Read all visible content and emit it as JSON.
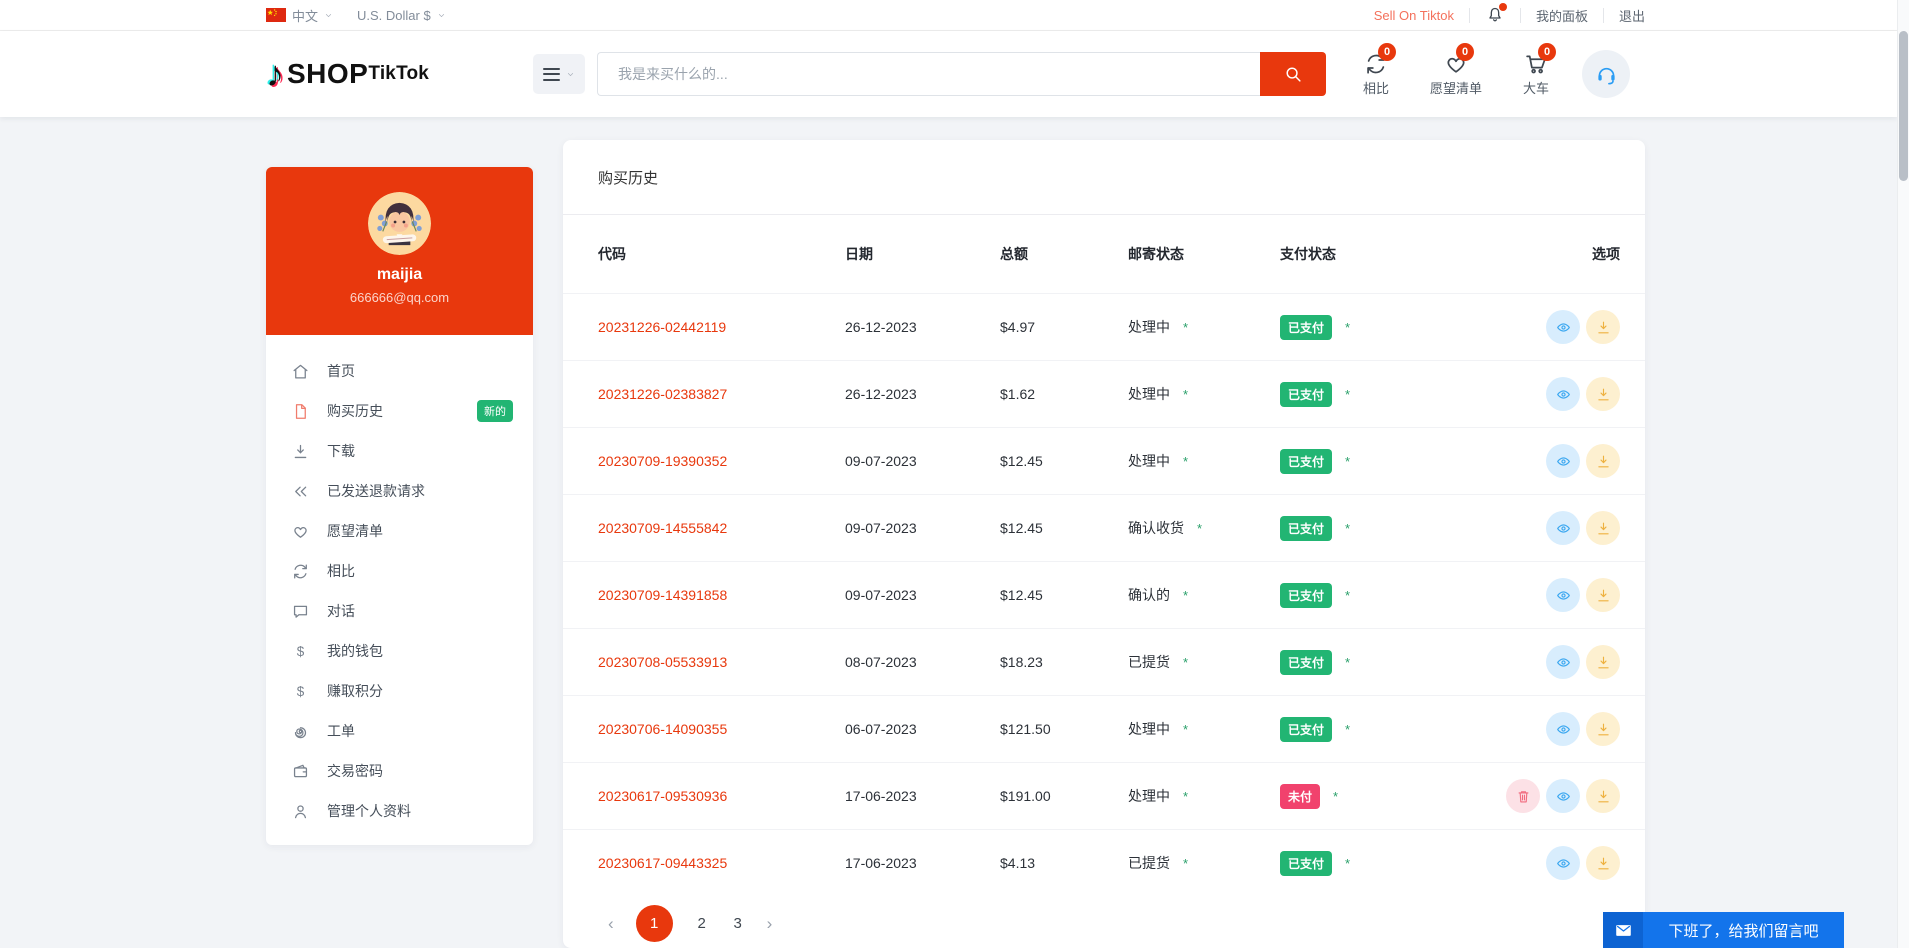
{
  "topbar": {
    "language": "中文",
    "currency": "U.S. Dollar $",
    "sell_on_tiktok": "Sell On Tiktok",
    "my_panel": "我的面板",
    "logout": "退出"
  },
  "header": {
    "logo_shop": "SHOP",
    "logo_tiktok": "TikTok",
    "search_placeholder": "我是来买什么的...",
    "compare": {
      "label": "相比",
      "count": "0"
    },
    "wishlist": {
      "label": "愿望清单",
      "count": "0"
    },
    "cart": {
      "label": "大车",
      "count": "0"
    }
  },
  "sidebar": {
    "user": {
      "name": "maijia",
      "email": "666666@qq.com"
    },
    "items": [
      {
        "label": "首页",
        "icon": "home-icon"
      },
      {
        "label": "购买历史",
        "icon": "file-icon",
        "active": true,
        "badge": "新的"
      },
      {
        "label": "下载",
        "icon": "download-icon"
      },
      {
        "label": "已发送退款请求",
        "icon": "rewind-icon"
      },
      {
        "label": "愿望清单",
        "icon": "heart-icon"
      },
      {
        "label": "相比",
        "icon": "compare-icon"
      },
      {
        "label": "对话",
        "icon": "chat-bubble-icon"
      },
      {
        "label": "我的钱包",
        "icon": "dollar-icon"
      },
      {
        "label": "赚取积分",
        "icon": "dollar-icon"
      },
      {
        "label": "工单",
        "icon": "spiral-icon"
      },
      {
        "label": "交易密码",
        "icon": "wallet-icon"
      },
      {
        "label": "管理个人资料",
        "icon": "person-icon"
      }
    ]
  },
  "main": {
    "title": "购买历史",
    "table": {
      "columns": [
        "代码",
        "日期",
        "总额",
        "邮寄状态",
        "支付状态",
        "选项"
      ],
      "required_mark": "*",
      "rows": [
        {
          "code": "20231226-02442119",
          "date": "26-12-2023",
          "total": "$4.97",
          "shipping": "处理中",
          "payment": "已支付",
          "paid": true,
          "deletable": false
        },
        {
          "code": "20231226-02383827",
          "date": "26-12-2023",
          "total": "$1.62",
          "shipping": "处理中",
          "payment": "已支付",
          "paid": true,
          "deletable": false
        },
        {
          "code": "20230709-19390352",
          "date": "09-07-2023",
          "total": "$12.45",
          "shipping": "处理中",
          "payment": "已支付",
          "paid": true,
          "deletable": false
        },
        {
          "code": "20230709-14555842",
          "date": "09-07-2023",
          "total": "$12.45",
          "shipping": "确认收货",
          "payment": "已支付",
          "paid": true,
          "deletable": false
        },
        {
          "code": "20230709-14391858",
          "date": "09-07-2023",
          "total": "$12.45",
          "shipping": "确认的",
          "payment": "已支付",
          "paid": true,
          "deletable": false
        },
        {
          "code": "20230708-05533913",
          "date": "08-07-2023",
          "total": "$18.23",
          "shipping": "已提货",
          "payment": "已支付",
          "paid": true,
          "deletable": false
        },
        {
          "code": "20230706-14090355",
          "date": "06-07-2023",
          "total": "$121.50",
          "shipping": "处理中",
          "payment": "已支付",
          "paid": true,
          "deletable": false
        },
        {
          "code": "20230617-09530936",
          "date": "17-06-2023",
          "total": "$191.00",
          "shipping": "处理中",
          "payment": "未付",
          "paid": false,
          "deletable": true
        },
        {
          "code": "20230617-09443325",
          "date": "17-06-2023",
          "total": "$4.13",
          "shipping": "已提货",
          "payment": "已支付",
          "paid": true,
          "deletable": false
        }
      ]
    },
    "pagination": {
      "prev": "‹",
      "pages": [
        "1",
        "2",
        "3"
      ],
      "active": "1",
      "next": "›"
    }
  },
  "chat_bar": {
    "message": "下班了，给我们留言吧"
  },
  "colors": {
    "primary": "#e8380d",
    "paid_green": "#22b573",
    "unpaid_pink": "#f1426d",
    "chat_blue": "#1374eb"
  }
}
